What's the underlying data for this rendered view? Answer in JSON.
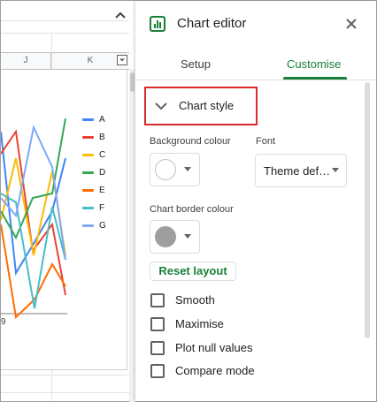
{
  "sheet": {
    "columns": [
      "J",
      "K"
    ],
    "x_tick_label": "9",
    "chart_data": {
      "type": "line",
      "title": "",
      "series": [
        {
          "name": "A",
          "color": "#4285f4"
        },
        {
          "name": "B",
          "color": "#ea4335"
        },
        {
          "name": "C",
          "color": "#fbbc04"
        },
        {
          "name": "D",
          "color": "#34a853"
        },
        {
          "name": "E",
          "color": "#ff6d01"
        },
        {
          "name": "F",
          "color": "#46bdc6"
        },
        {
          "name": "G",
          "color": "#7baaf7"
        }
      ],
      "legend_position": "right"
    }
  },
  "editor": {
    "title": "Chart editor",
    "icons": {
      "header": "chart-icon",
      "close": "close-icon",
      "section": "chevron-down-icon"
    },
    "tabs": [
      {
        "label": "Setup",
        "active": false
      },
      {
        "label": "Customise",
        "active": true
      }
    ],
    "accent_color": "#188038",
    "highlight_color": "#d92b2b",
    "section": {
      "title": "Chart style",
      "expanded": true
    },
    "background_colour": {
      "label": "Background colour",
      "value": "#ffffff"
    },
    "font": {
      "label": "Font",
      "value": "Theme def…"
    },
    "border_colour": {
      "label": "Chart border colour",
      "value": "#9e9e9e"
    },
    "reset_label": "Reset layout",
    "checkboxes": [
      {
        "label": "Smooth",
        "checked": false
      },
      {
        "label": "Maximise",
        "checked": false
      },
      {
        "label": "Plot null values",
        "checked": false
      },
      {
        "label": "Compare mode",
        "checked": false
      }
    ]
  }
}
